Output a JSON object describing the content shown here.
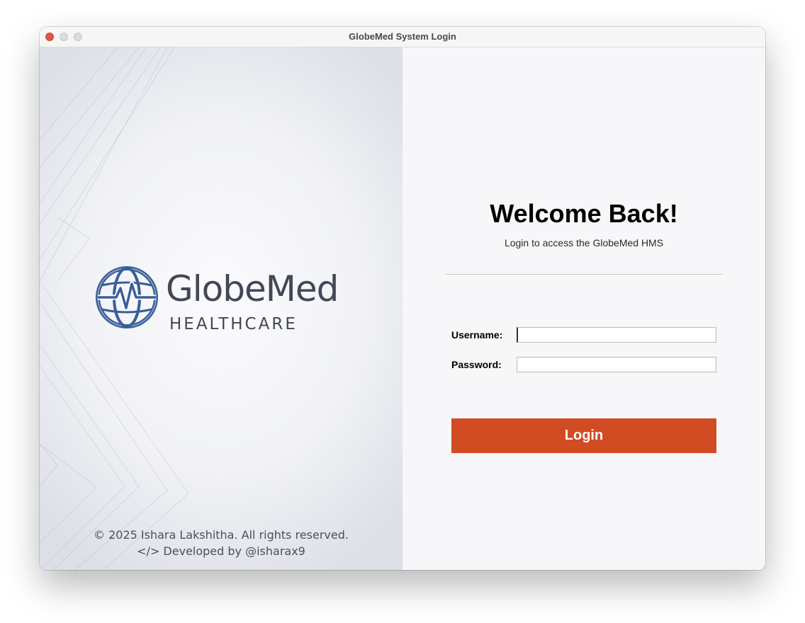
{
  "window": {
    "title": "GlobeMed System Login"
  },
  "brand": {
    "name": "GlobeMed",
    "tagline": "HEALTHCARE",
    "logo_icon": "globe-heartbeat-icon",
    "colors": {
      "logo_blue": "#3b5e98",
      "logo_text": "#434755",
      "accent": "#d14b23"
    }
  },
  "footer": {
    "copyright": "© 2025 Ishara Lakshitha. All rights reserved.",
    "developer": "</> Developed by @isharax9"
  },
  "login": {
    "heading": "Welcome Back!",
    "subtitle": "Login to access the GlobeMed HMS",
    "username_label": "Username:",
    "username_value": "",
    "password_label": "Password:",
    "password_value": "",
    "button_label": "Login"
  }
}
